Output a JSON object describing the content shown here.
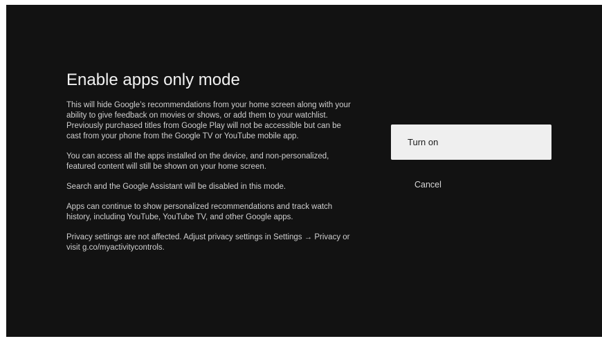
{
  "dialog": {
    "title": "Enable apps only mode",
    "paragraphs": [
      "This will hide Google’s recommendations from your home screen along with your ability to give feedback on movies or shows, or add them to your watchlist. Previously purchased titles from Google Play will not be accessible but can be cast from your phone from the Google TV or YouTube mobile app.",
      "You can access all the apps installed on the device, and non-personalized, featured content will still be shown on your home screen.",
      "Search and the Google Assistant will be disabled in this mode.",
      "Apps can continue to show personalized recommendations and track watch history, including YouTube, YouTube TV, and other Google apps.",
      "Privacy settings are not affected. Adjust privacy settings in Settings → Privacy or visit g.co/myactivitycontrols."
    ]
  },
  "actions": {
    "turn_on_label": "Turn on",
    "cancel_label": "Cancel"
  },
  "colors": {
    "background": "#121212",
    "title_text": "#f1f1f1",
    "body_text": "#cfcfcf",
    "focused_button_bg": "#efefef",
    "focused_button_text": "#1b1b1b"
  }
}
